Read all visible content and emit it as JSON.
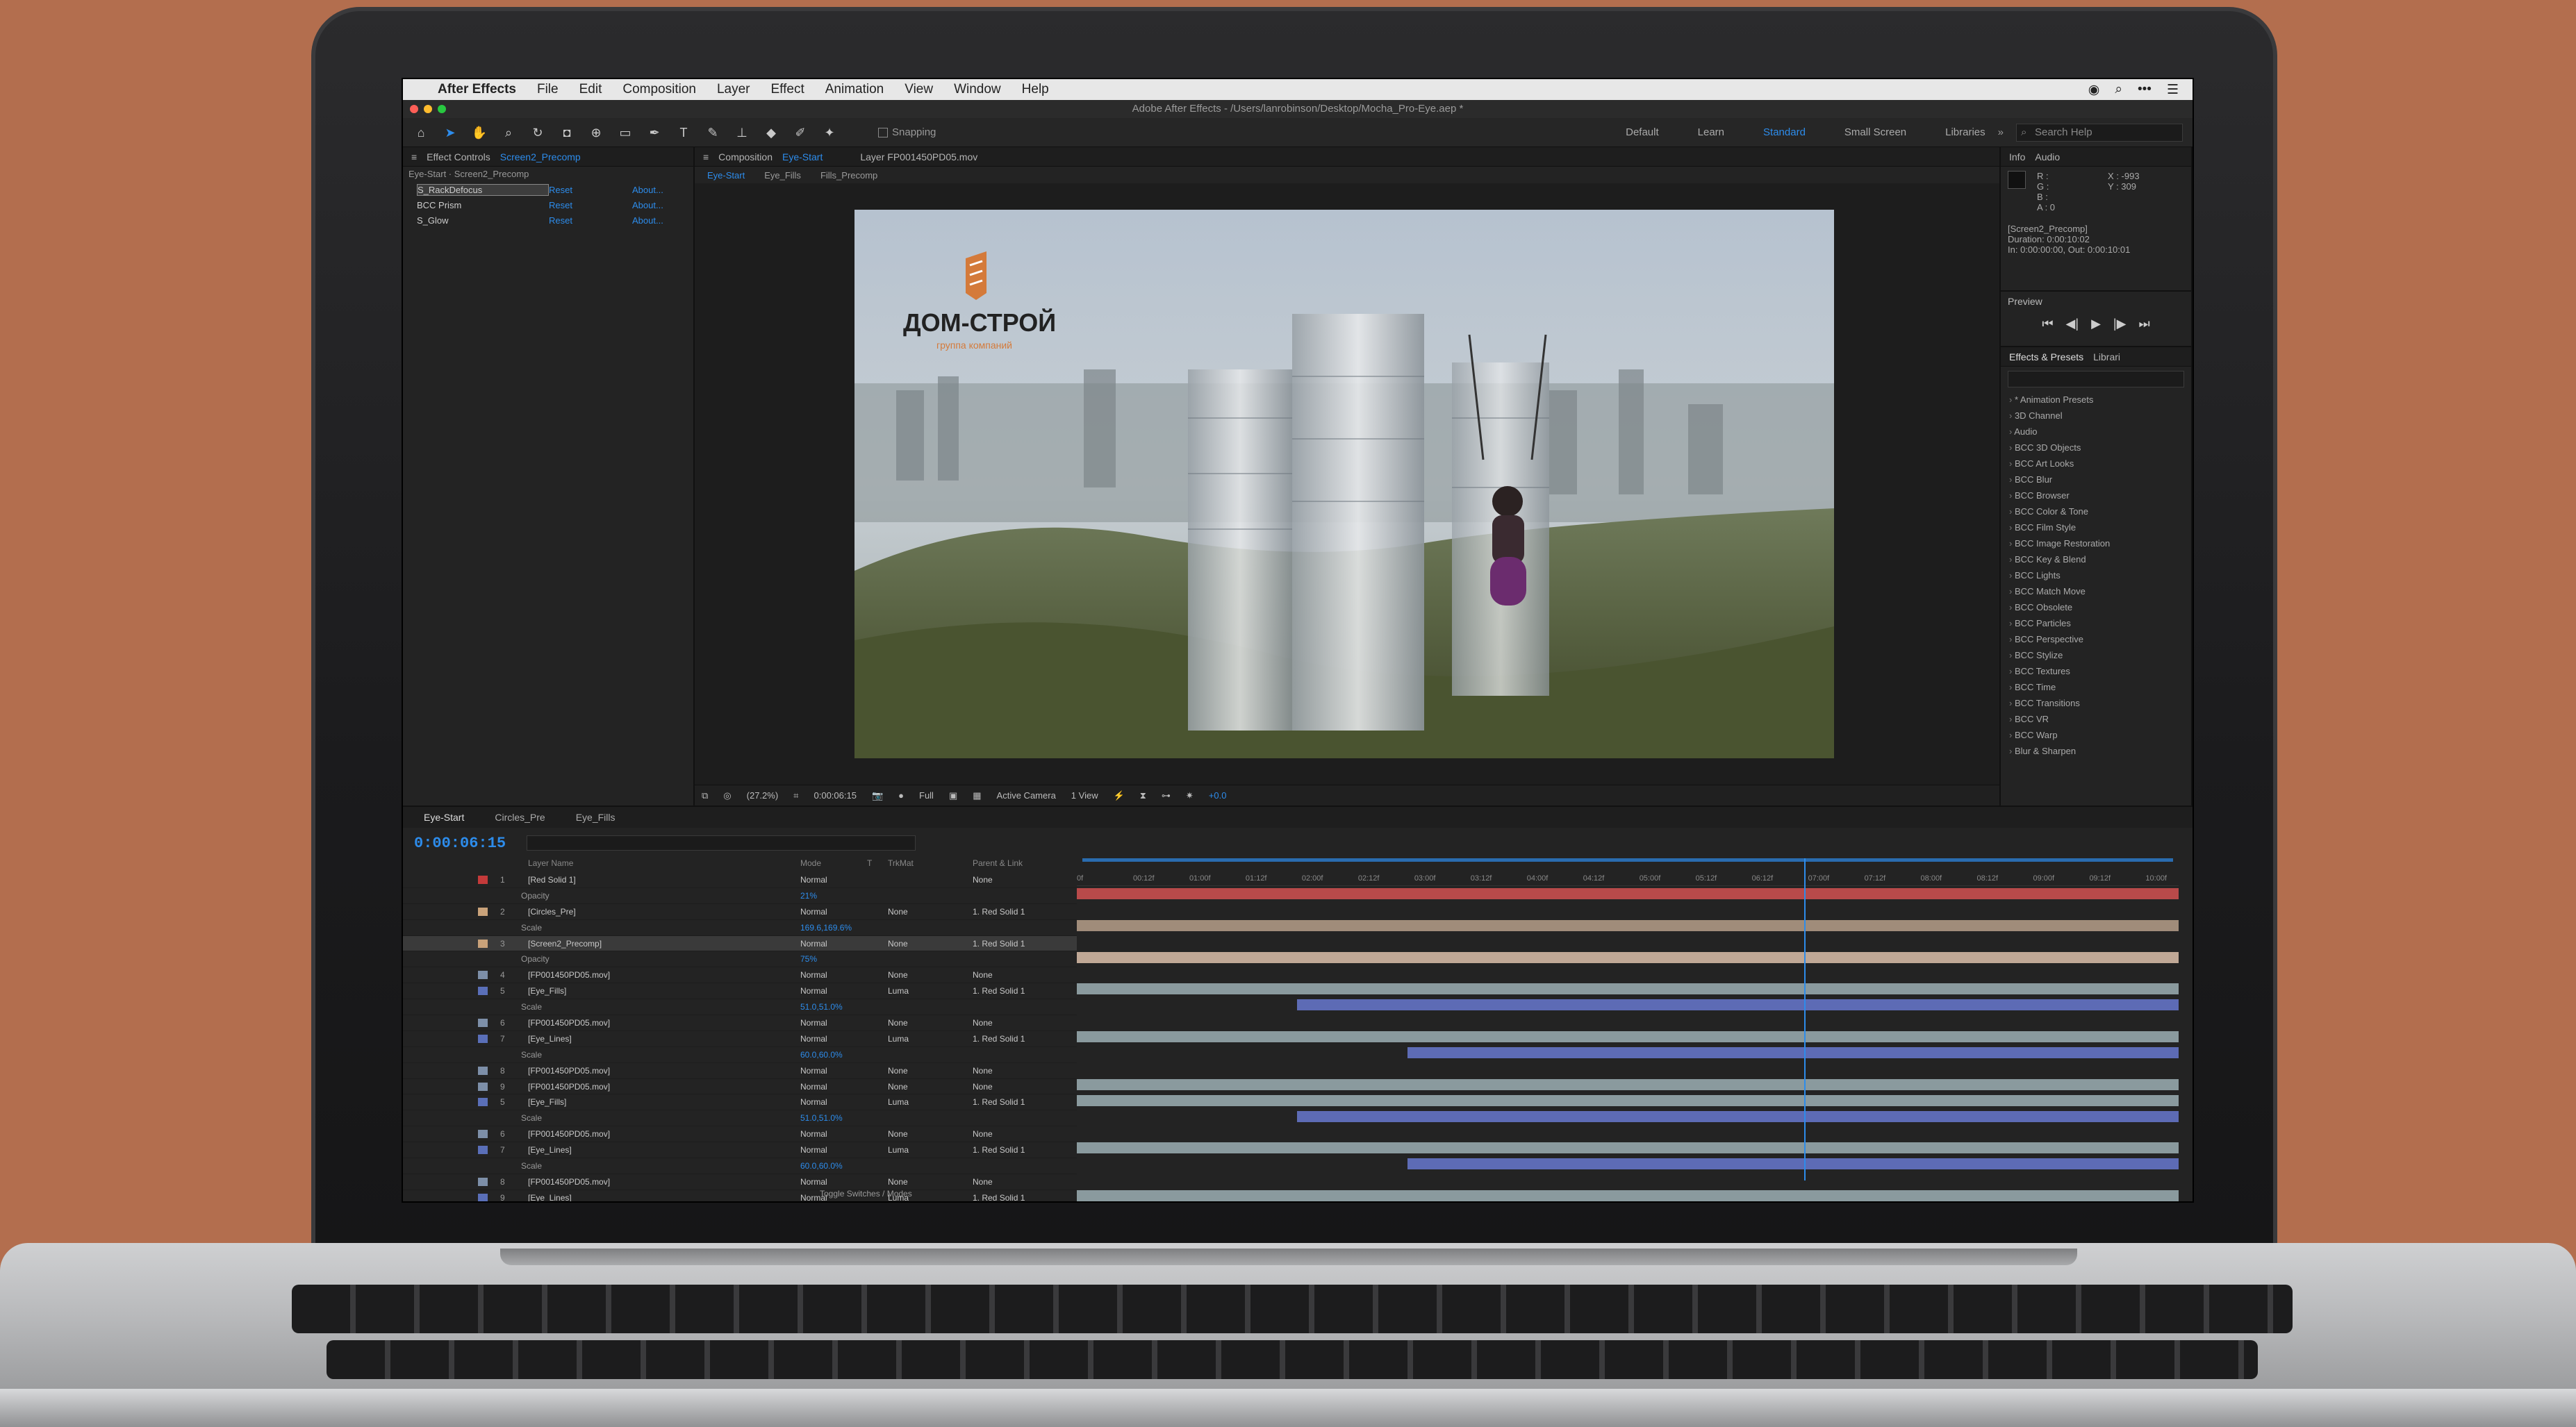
{
  "menubar": {
    "app": "After Effects",
    "items": [
      "File",
      "Edit",
      "Composition",
      "Layer",
      "Effect",
      "Animation",
      "View",
      "Window",
      "Help"
    ]
  },
  "window": {
    "title": "Adobe After Effects - /Users/lanrobinson/Desktop/Mocha_Pro-Eye.aep *"
  },
  "toolbar": {
    "snapping": "Snapping",
    "workspaces": [
      "Default",
      "Learn",
      "Standard",
      "Small Screen",
      "Libraries"
    ],
    "active_workspace": "Standard",
    "search_placeholder": "Search Help"
  },
  "effect_controls": {
    "tab_label": "Effect Controls",
    "tab_target": "Screen2_Precomp",
    "subtitle": "Eye-Start · Screen2_Precomp",
    "effects": [
      {
        "name": "S_RackDefocus",
        "reset": "Reset",
        "about": "About..."
      },
      {
        "name": "BCC Prism",
        "reset": "Reset",
        "about": "About..."
      },
      {
        "name": "S_Glow",
        "reset": "Reset",
        "about": "About..."
      }
    ]
  },
  "composition": {
    "tab_label": "Composition",
    "tab_target": "Eye-Start",
    "layer_tab": "Layer FP001450PD05.mov",
    "subtabs": [
      "Eye-Start",
      "Eye_Fills",
      "Fills_Precomp"
    ],
    "logo_text": "ДОМ-СТРОЙ",
    "logo_sub": "группа компаний",
    "viewer_bar": {
      "zoom": "(27.2%)",
      "time": "0:00:06:15",
      "resolution": "Full",
      "camera": "Active Camera",
      "views": "1 View",
      "exposure": "+0.0"
    }
  },
  "info_panel": {
    "tabs": [
      "Info",
      "Audio"
    ],
    "rgb": [
      "R :",
      "G :",
      "B :",
      "A : 0"
    ],
    "coords": [
      "X : -993",
      "Y : 309"
    ],
    "layer": "[Screen2_Precomp]",
    "duration": "Duration: 0:00:10:02",
    "inout": "In: 0:00:00:00, Out: 0:00:10:01"
  },
  "preview_panel": {
    "title": "Preview",
    "controls": [
      "⏮",
      "◀|",
      "▶",
      "|▶",
      "⏭"
    ]
  },
  "effects_presets": {
    "tabs": [
      "Effects & Presets",
      "Librari"
    ],
    "items": [
      "* Animation Presets",
      "3D Channel",
      "Audio",
      "BCC 3D Objects",
      "BCC Art Looks",
      "BCC Blur",
      "BCC Browser",
      "BCC Color & Tone",
      "BCC Film Style",
      "BCC Image Restoration",
      "BCC Key & Blend",
      "BCC Lights",
      "BCC Match Move",
      "BCC Obsolete",
      "BCC Particles",
      "BCC Perspective",
      "BCC Stylize",
      "BCC Textures",
      "BCC Time",
      "BCC Transitions",
      "BCC VR",
      "BCC Warp",
      "Blur & Sharpen"
    ]
  },
  "timeline": {
    "tabs": [
      "Eye-Start",
      "Circles_Pre",
      "Eye_Fills"
    ],
    "timecode": "0:00:06:15",
    "columns": {
      "layer": "Layer Name",
      "mode": "Mode",
      "t": "T",
      "trkmat": "TrkMat",
      "parent": "Parent & Link"
    },
    "ruler": [
      "0f",
      "00:12f",
      "01:00f",
      "01:12f",
      "02:00f",
      "02:12f",
      "03:00f",
      "03:12f",
      "04:00f",
      "04:12f",
      "05:00f",
      "05:12f",
      "06:12f",
      "07:00f",
      "07:12f",
      "08:00f",
      "08:12f",
      "09:00f",
      "09:12f",
      "10:00f"
    ],
    "footer": "Toggle Switches / Modes",
    "layers": [
      {
        "num": "1",
        "name": "[Red Solid 1]",
        "mode": "Normal",
        "trk": "",
        "parent": "None",
        "label": "#c43a3a",
        "bar_color": "#b84a4a",
        "start": 0,
        "sel": false
      },
      {
        "sub": true,
        "name": "Opacity",
        "val": "21%"
      },
      {
        "num": "2",
        "name": "[Circles_Pre]",
        "mode": "Normal",
        "trk": "None",
        "parent": "1. Red Solid 1",
        "label": "#c9a27a",
        "bar_color": "#a08c7a",
        "start": 0,
        "sel": false
      },
      {
        "sub": true,
        "name": "Scale",
        "val": "169.6,169.6%"
      },
      {
        "num": "3",
        "name": "[Screen2_Precomp]",
        "mode": "Normal",
        "trk": "None",
        "parent": "1. Red Solid 1",
        "label": "#c9a27a",
        "bar_color": "#c0a896",
        "start": 0,
        "sel": true
      },
      {
        "sub": true,
        "name": "Opacity",
        "val": "75%"
      },
      {
        "num": "4",
        "name": "[FP001450PD05.mov]",
        "mode": "Normal",
        "trk": "None",
        "parent": "None",
        "label": "#7d8fa8",
        "bar_color": "#8a9a9e",
        "start": 0,
        "sel": false
      },
      {
        "num": "5",
        "name": "[Eye_Fills]",
        "mode": "Normal",
        "trk": "Luma",
        "parent": "1. Red Solid 1",
        "label": "#5a6fb8",
        "bar_color": "#5d6bb5",
        "start": 0.2,
        "sel": false
      },
      {
        "sub": true,
        "name": "Scale",
        "val": "51.0,51.0%"
      },
      {
        "num": "6",
        "name": "[FP001450PD05.mov]",
        "mode": "Normal",
        "trk": "None",
        "parent": "None",
        "label": "#7d8fa8",
        "bar_color": "#8a9a9e",
        "start": 0,
        "sel": false
      },
      {
        "num": "7",
        "name": "[Eye_Lines]",
        "mode": "Normal",
        "trk": "Luma",
        "parent": "1. Red Solid 1",
        "label": "#5a6fb8",
        "bar_color": "#5d6bb5",
        "start": 0.3,
        "sel": false
      },
      {
        "sub": true,
        "name": "Scale",
        "val": "60.0,60.0%"
      },
      {
        "num": "8",
        "name": "[FP001450PD05.mov]",
        "mode": "Normal",
        "trk": "None",
        "parent": "None",
        "label": "#7d8fa8",
        "bar_color": "#8a9a9e",
        "start": 0,
        "sel": false
      },
      {
        "num": "9",
        "name": "[FP001450PD05.mov]",
        "mode": "Normal",
        "trk": "None",
        "parent": "None",
        "label": "#7d8fa8",
        "bar_color": "#8a9a9e",
        "start": 0,
        "sel": false
      },
      {
        "num": "5",
        "name": "[Eye_Fills]",
        "mode": "Normal",
        "trk": "Luma",
        "parent": "1. Red Solid 1",
        "label": "#5a6fb8",
        "bar_color": "#5d6bb5",
        "start": 0.2,
        "sel": false
      },
      {
        "sub": true,
        "name": "Scale",
        "val": "51.0,51.0%"
      },
      {
        "num": "6",
        "name": "[FP001450PD05.mov]",
        "mode": "Normal",
        "trk": "None",
        "parent": "None",
        "label": "#7d8fa8",
        "bar_color": "#8a9a9e",
        "start": 0,
        "sel": false
      },
      {
        "num": "7",
        "name": "[Eye_Lines]",
        "mode": "Normal",
        "trk": "Luma",
        "parent": "1. Red Solid 1",
        "label": "#5a6fb8",
        "bar_color": "#5d6bb5",
        "start": 0.3,
        "sel": false
      },
      {
        "sub": true,
        "name": "Scale",
        "val": "60.0,60.0%"
      },
      {
        "num": "8",
        "name": "[FP001450PD05.mov]",
        "mode": "Normal",
        "trk": "None",
        "parent": "None",
        "label": "#7d8fa8",
        "bar_color": "#8a9a9e",
        "start": 0,
        "sel": false
      },
      {
        "num": "9",
        "name": "[Eye_Lines]",
        "mode": "Normal",
        "trk": "Luma",
        "parent": "1. Red Solid 1",
        "label": "#5a6fb8",
        "bar_color": "#5d6bb5",
        "start": 0.2,
        "sel": false
      }
    ],
    "playhead_fraction": 0.66,
    "accent": "#2d8ceb"
  }
}
